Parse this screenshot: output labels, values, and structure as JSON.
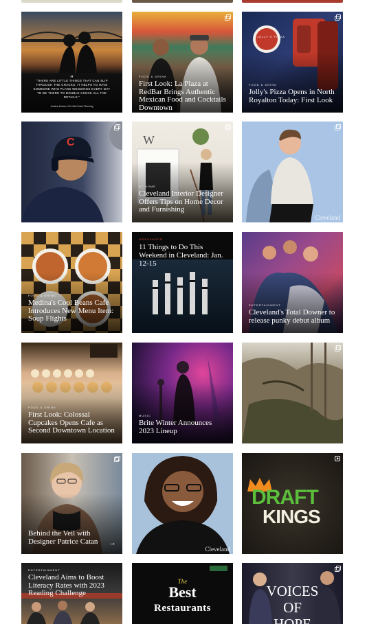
{
  "top_strips": [
    "#ddd9c8",
    "#6b5847",
    "#c0392b"
  ],
  "tiles": [
    {
      "id": "t1",
      "quote": "\"THERE ARE LITTLE THINGS THAT CAN SLIP THROUGH THE CRACKS. IT HELPS TO HAVE SOMEONE WHO PLANS WEDDINGS EVERY DAY TO BE THERE TO DOUBLE CHECK ALL THE DETAILS.\"",
      "author": "Jessica Kramer, Oh Hello Event Planning",
      "quote_mark": "“"
    },
    {
      "id": "t2",
      "kicker": "FOOD & DRINK",
      "title": "First Look: La Plaza at RedBar Brings Authentic Mexican Food and Cocktails Downtown"
    },
    {
      "id": "t3",
      "kicker": "FOOD & DRINK",
      "title": "Jolly's Pizza Opens in North Royalton Today: First Look",
      "sign": "JOLLY'S PIZZA"
    },
    {
      "id": "t4",
      "cap_letter": "C"
    },
    {
      "id": "t5",
      "kicker": "AT HOME",
      "title": "Cleveland Interior Designer Offers Tips on Home Decor and Furnishing",
      "wall_letter": "W"
    },
    {
      "id": "t6",
      "watermark": "Cleveland"
    },
    {
      "id": "t7",
      "kicker": "FOOD & DRINK",
      "title": "Medina's Cool Beans Cafe Introduces New Menu Item: Soup Flights"
    },
    {
      "id": "t8",
      "kicker": "WEEKENDER",
      "title": "11 Things to Do This Weekend in Cleveland: Jan. 12-15"
    },
    {
      "id": "t9",
      "kicker": "ENTERTAINMENT",
      "title": "Cleveland's Total Downer to release punky debut album"
    },
    {
      "id": "t10",
      "kicker": "FOOD & DRINK",
      "title": "First Look: Colossal Cupcakes Opens Cafe as Second Downtown Location"
    },
    {
      "id": "t11",
      "kicker": "MUSIC",
      "title": "Brite Winter Announces 2023 Lineup"
    },
    {
      "id": "t12"
    },
    {
      "id": "t13",
      "title": "Behind the Veil with Designer Patrice Catan",
      "arrow": "→"
    },
    {
      "id": "t14",
      "watermark": "Cleveland"
    },
    {
      "id": "t15",
      "logo_line1": "DRAFT",
      "logo_line2": "KINGS"
    },
    {
      "id": "t16",
      "kicker": "ENTERTAINMENT",
      "title": "Cleveland Aims to Boost Literacy Rates with 2023 Reading Challenge"
    },
    {
      "id": "t17",
      "script": "The",
      "big_line1": "Best",
      "big_line2": "Restaurants"
    },
    {
      "id": "t18",
      "big_line1": "VOICES",
      "big_line2": "OF",
      "big_line3": "HOPE"
    }
  ]
}
